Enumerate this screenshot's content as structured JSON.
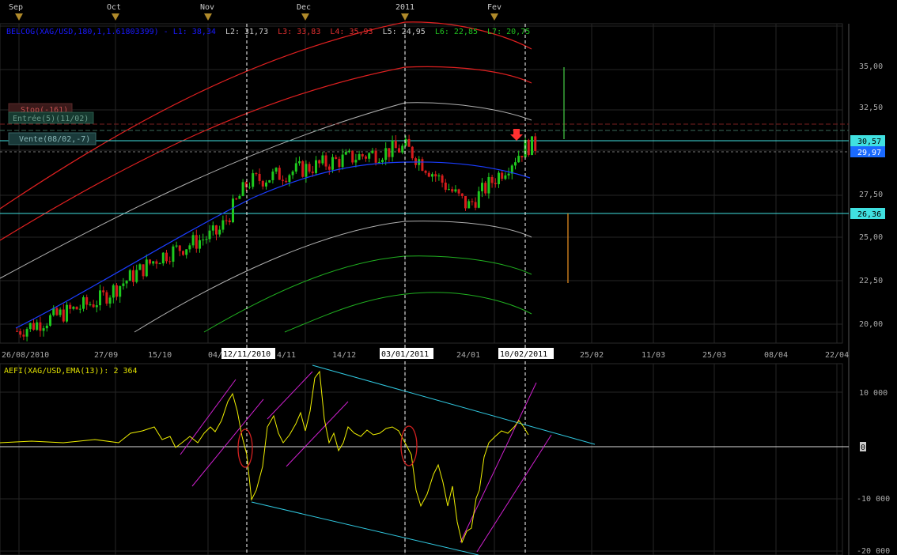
{
  "months": [
    "Sep",
    "Oct",
    "Nov",
    "Dec",
    "2011",
    "Fev"
  ],
  "header": {
    "main_label": "BELCOG(XAG/USD,180,1,1.61803399) - L1: 38,34",
    "l2": "L2: 31,73",
    "l3": "L3: 33,83",
    "l4": "L4: 35,93",
    "l5": "L5: 24,95",
    "l6": "L6: 22,85",
    "l7": "L7: 20,75"
  },
  "orders": {
    "stop": "Stop(-161)",
    "entry": "Entrée(5)(11/02)",
    "sell": "Vente(08/02,-7)"
  },
  "price_axis": {
    "ticks": [
      "35,00",
      "32,50",
      "30,57",
      "29,97",
      "27,50",
      "26,36",
      "25,00",
      "22,50",
      "20,00"
    ]
  },
  "date_axis": {
    "ticks": [
      "26/08/2010",
      "27/09",
      "15/10",
      "04/1",
      "14/12",
      "24/01",
      "25/02",
      "11/03",
      "25/03",
      "08/04",
      "22/04"
    ],
    "highlighted": [
      "12/11/2010",
      "03/01/2011",
      "10/02/2011"
    ],
    "partial": "4/11"
  },
  "indicator": {
    "label": "AEFI(XAG/USD,EMA(13)): 2 364",
    "ticks": [
      "10 000",
      "0",
      "-10 000",
      "-20 000"
    ]
  },
  "colors": {
    "background": "#000000",
    "grid": "#333333",
    "bull": "#1ec81e",
    "bear": "#d61c1c",
    "ma": "#1a3dff",
    "band_red": "#e02020",
    "band_white": "#b0b0b0",
    "band_green": "#20b020",
    "level_cyan": "#40e0e0",
    "force": "#f0f000",
    "channel_magenta": "#d020d0",
    "channel_cyan": "#30c8e0",
    "circle": "#d02020",
    "label_red": "#d03030",
    "label_blue": "#1a1aff"
  },
  "chart_data": {
    "type": "candlestick",
    "instrument": "XAG/USD",
    "levels": {
      "horizontal_upper": 30.57,
      "last_price": 29.97,
      "horizontal_lower": 26.36
    },
    "price_range": [
      19.5,
      37.5
    ],
    "vertical_markers": [
      "12/11/2010",
      "03/01/2011",
      "10/02/2011"
    ],
    "bands": {
      "L1": 38.34,
      "L2": 31.73,
      "L3": 33.83,
      "L4": 35.93,
      "L5": 24.95,
      "L6": 22.85,
      "L7": 20.75
    },
    "close_path": [
      {
        "d": "26/08/2010",
        "v": 19.6
      },
      {
        "d": "27/09",
        "v": 21.4
      },
      {
        "d": "15/10",
        "v": 23.9
      },
      {
        "d": "04/11",
        "v": 25.3
      },
      {
        "d": "12/11/2010",
        "v": 28.2
      },
      {
        "d": "14/12",
        "v": 29.5
      },
      {
        "d": "03/01/2011",
        "v": 30.2
      },
      {
        "d": "24/01",
        "v": 26.8
      },
      {
        "d": "10/02/2011",
        "v": 30.3
      }
    ],
    "indicator_range": [
      -20000,
      15000
    ],
    "indicator_value": 2364
  }
}
